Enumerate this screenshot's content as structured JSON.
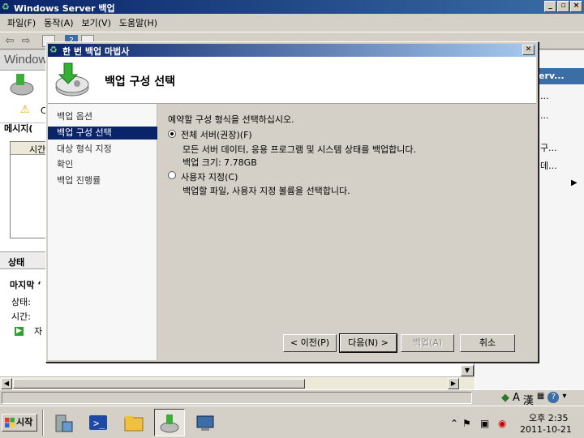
{
  "app": {
    "title": "Windows Server 백업",
    "window_buttons": [
      "_",
      "▫",
      "×"
    ]
  },
  "menu": [
    "파일(F)",
    "동작(A)",
    "보기(V)",
    "도움말(H)"
  ],
  "background": {
    "workspace_title": "Windows",
    "warning_text": "C",
    "messages_label": "메시지(",
    "column_header": "시간",
    "status_section": "상태",
    "last_backup_label": "마지막 ‘",
    "state_label": "상태:",
    "time_label": "시간:",
    "details_link": "자",
    "actions_header": "erv...",
    "actions": [
      "...",
      "...",
      "구...",
      "데...",
      "▶"
    ]
  },
  "dialog": {
    "title": "한 번 백업 마법사",
    "heading": "백업 구성 선택",
    "nav": [
      "백업 옵션",
      "백업 구성 선택",
      "대상 형식 지정",
      "확인",
      "백업 진행률"
    ],
    "selected_nav_index": 1,
    "prompt": "예약할 구성 형식을 선택하십시오.",
    "options": [
      {
        "label": "전체 서버(권장)(F)",
        "description": "모든 서버 데이터, 응용 프로그램 및 시스템 상태를 백업합니다.",
        "size": "백업 크기: 7.78GB",
        "selected": true
      },
      {
        "label": "사용자 지정(C)",
        "description": "백업할 파일, 사용자 지정 볼륨을 선택합니다.",
        "selected": false
      }
    ],
    "buttons": {
      "back": "< 이전(P)",
      "next": "다음(N) >",
      "backup": "백업(A)",
      "cancel": "취소"
    }
  },
  "statusbar": {
    "ime": [
      "A",
      "漢"
    ]
  },
  "taskbar": {
    "start": "시작",
    "clock_time": "오후 2:35",
    "clock_date": "2011-10-21"
  }
}
